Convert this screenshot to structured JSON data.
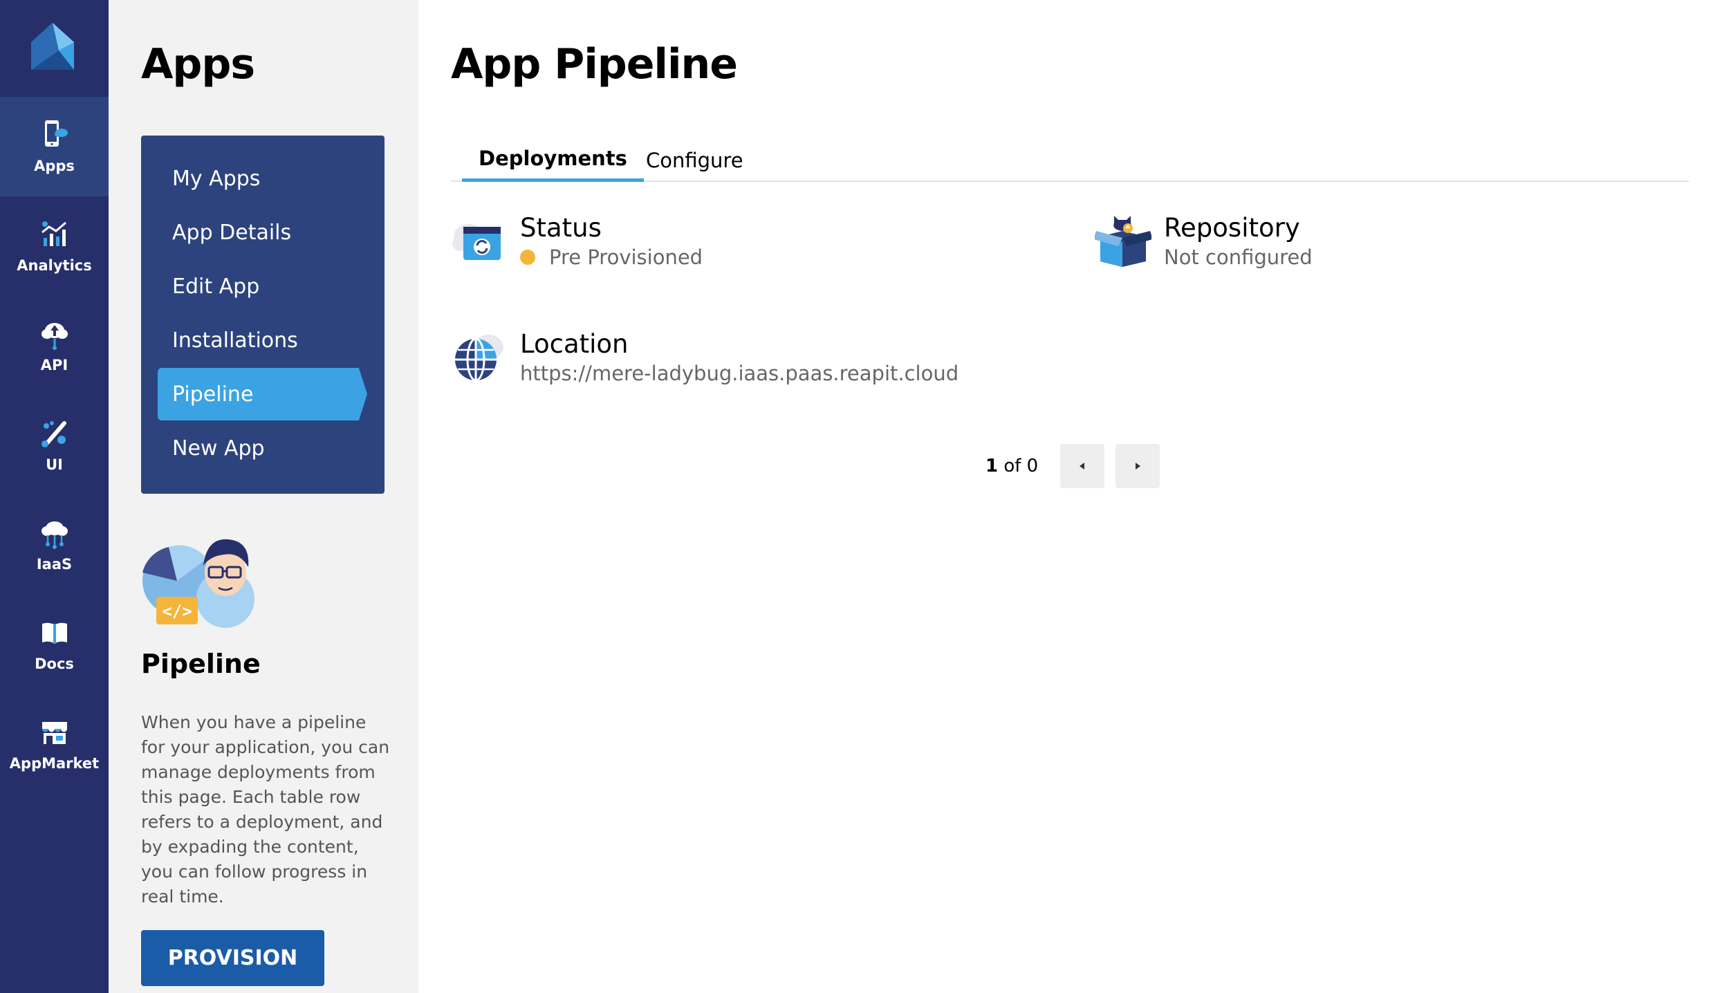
{
  "nav": {
    "items": [
      {
        "label": "Apps",
        "icon": "apps-phone-cloud-icon",
        "active": true
      },
      {
        "label": "Analytics",
        "icon": "analytics-chart-icon",
        "active": false
      },
      {
        "label": "API",
        "icon": "api-cloud-upload-icon",
        "active": false
      },
      {
        "label": "UI",
        "icon": "ui-brush-icon",
        "active": false
      },
      {
        "label": "IaaS",
        "icon": "iaas-cloud-network-icon",
        "active": false
      },
      {
        "label": "Docs",
        "icon": "docs-book-icon",
        "active": false
      },
      {
        "label": "AppMarket",
        "icon": "appmarket-store-icon",
        "active": false
      }
    ]
  },
  "panel": {
    "title": "Apps",
    "menu": [
      {
        "label": "My Apps",
        "active": false
      },
      {
        "label": "App Details",
        "active": false
      },
      {
        "label": "Edit App",
        "active": false
      },
      {
        "label": "Installations",
        "active": false
      },
      {
        "label": "Pipeline",
        "active": true
      },
      {
        "label": "New App",
        "active": false
      }
    ],
    "help_title": "Pipeline",
    "help_text": "When you have a pipeline for your application, you can manage deployments from this page. Each table row refers to a deployment, and by expading the content, you can follow progress in real time.",
    "provision_label": "PROVISION"
  },
  "main": {
    "title": "App Pipeline",
    "tabs": [
      {
        "label": "Deployments",
        "active": true
      },
      {
        "label": "Configure",
        "active": false
      }
    ],
    "status": {
      "title": "Status",
      "value": "Pre Provisioned",
      "dot_color": "#f5b43a"
    },
    "repository": {
      "title": "Repository",
      "value": "Not configured"
    },
    "location": {
      "title": "Location",
      "value": "https://mere-ladybug.iaas.paas.reapit.cloud"
    },
    "pager": {
      "current": "1",
      "of_text": "of 0"
    }
  },
  "colors": {
    "nav_bg": "#262f69",
    "nav_active": "#2d437e",
    "submenu_bg": "#2d437e",
    "accent": "#3ba3e3",
    "button": "#1b5ca8",
    "panel_bg": "#f2f2f2"
  }
}
